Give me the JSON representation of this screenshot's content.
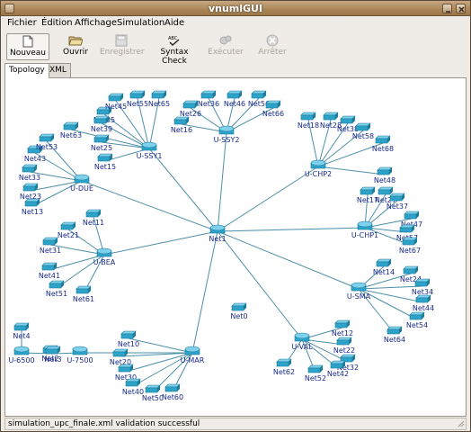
{
  "window": {
    "title": "vnumlGUI"
  },
  "menu": [
    {
      "label": "Fichier"
    },
    {
      "label": "Édition"
    },
    {
      "label": "Affichage"
    },
    {
      "label": "Simulation"
    },
    {
      "label": "Aide"
    }
  ],
  "toolbar": [
    {
      "label": "Nouveau",
      "icon": "new-file-icon",
      "enabled": true
    },
    {
      "label": "Ouvrir",
      "icon": "open-folder-icon",
      "enabled": true
    },
    {
      "label": "Enregistrer",
      "icon": "save-icon",
      "enabled": false
    },
    {
      "label": "Syntax Check",
      "icon": "syntax-check-icon",
      "enabled": true
    },
    {
      "label": "Exécuter",
      "icon": "execute-icon",
      "enabled": false
    },
    {
      "label": "Arrêter",
      "icon": "stop-icon",
      "enabled": false
    }
  ],
  "tabs": [
    {
      "label": "Topology",
      "selected": true
    },
    {
      "label": "XML",
      "selected": false
    }
  ],
  "topology": {
    "colors": {
      "link": "#4d8fa8",
      "node": "#2ea3c9",
      "node_dark": "#1b7c9c",
      "label": "#1a2a8c"
    },
    "routers": [
      "Net1",
      "U-SSY1",
      "U-SSY2",
      "U-CHP2",
      "U-CHP1",
      "U-SMA",
      "U-VAL",
      "U-MAR",
      "U-BEA",
      "U-DUE",
      "U-7500",
      "U-6500"
    ],
    "switches": [
      "Net0",
      "Net2",
      "Net3",
      "Net4",
      "Net10",
      "Net11",
      "Net12",
      "Net13",
      "Net14",
      "Net15",
      "Net16",
      "Net17",
      "Net18",
      "Net20",
      "Net21",
      "Net22",
      "Net23",
      "Net24",
      "Net25",
      "Net26",
      "Net27",
      "Net28",
      "Net30",
      "Net31",
      "Net32",
      "Net33",
      "Net34",
      "Net35",
      "Net36",
      "Net37",
      "Net38",
      "Net39",
      "Net40",
      "Net41",
      "Net42",
      "Net43",
      "Net44",
      "Net45",
      "Net46",
      "Net47",
      "Net48",
      "Net50",
      "Net51",
      "Net52",
      "Net53",
      "Net54",
      "Net55",
      "Net56",
      "Net57",
      "Net58",
      "Net60",
      "Net61",
      "Net62",
      "Net63",
      "Net64",
      "Net65",
      "Net66",
      "Net67",
      "Net68"
    ]
  },
  "status": {
    "message": "simulation_upc_finale.xml validation successful"
  }
}
